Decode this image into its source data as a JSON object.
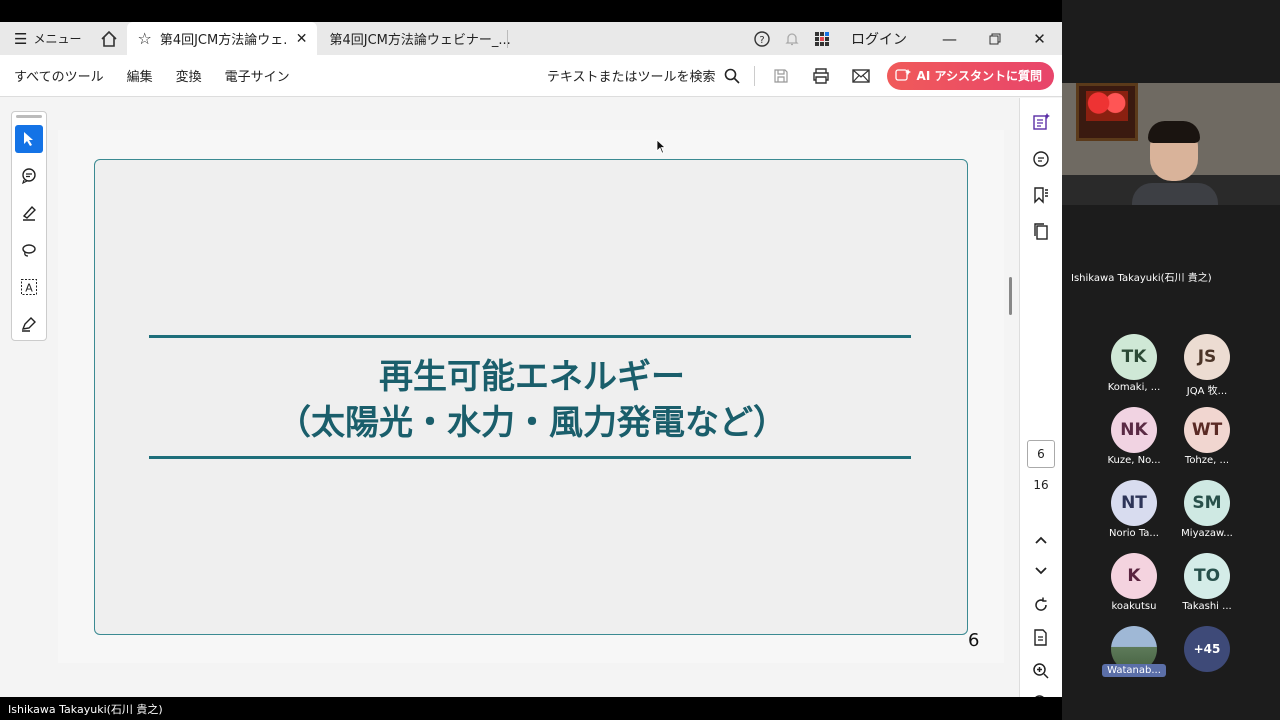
{
  "tabbar": {
    "menu_label": "メニュー",
    "tabs": [
      {
        "label": "第4回JCM方法論ウェ..."
      },
      {
        "label": "第4回JCM方法論ウェビナー_..."
      }
    ],
    "login_label": "ログイン"
  },
  "toolbar": {
    "items": [
      "すべてのツール",
      "編集",
      "変換",
      "電子サイン"
    ],
    "search_label": "テキストまたはツールを検索",
    "ai_label": "AI アシスタントに質問"
  },
  "slide": {
    "title_line1": "再生可能エネルギー",
    "title_line2": "（太陽光・水力・風力発電など）",
    "page_number": "6"
  },
  "pager": {
    "current": "6",
    "total": "16"
  },
  "zoom": {
    "speaker_name": "Ishikawa Takayuki(石川 貴之)",
    "participants": [
      {
        "initials": "TK",
        "name": "Komaki, ..."
      },
      {
        "initials": "JS",
        "name": "JQA 牧..."
      },
      {
        "initials": "NK",
        "name": "Kuze, No..."
      },
      {
        "initials": "WT",
        "name": "Tohze, ..."
      },
      {
        "initials": "NT",
        "name": "Norio Ta..."
      },
      {
        "initials": "SM",
        "name": "Miyazaw..."
      },
      {
        "initials": "K",
        "name": "koakutsu"
      },
      {
        "initials": "TO",
        "name": "Takashi ..."
      },
      {
        "initials": "",
        "name": "Watanab..."
      },
      {
        "initials": "+45",
        "name": ""
      }
    ],
    "bottom_name": "Ishikawa Takayuki(石川 貴之)"
  }
}
